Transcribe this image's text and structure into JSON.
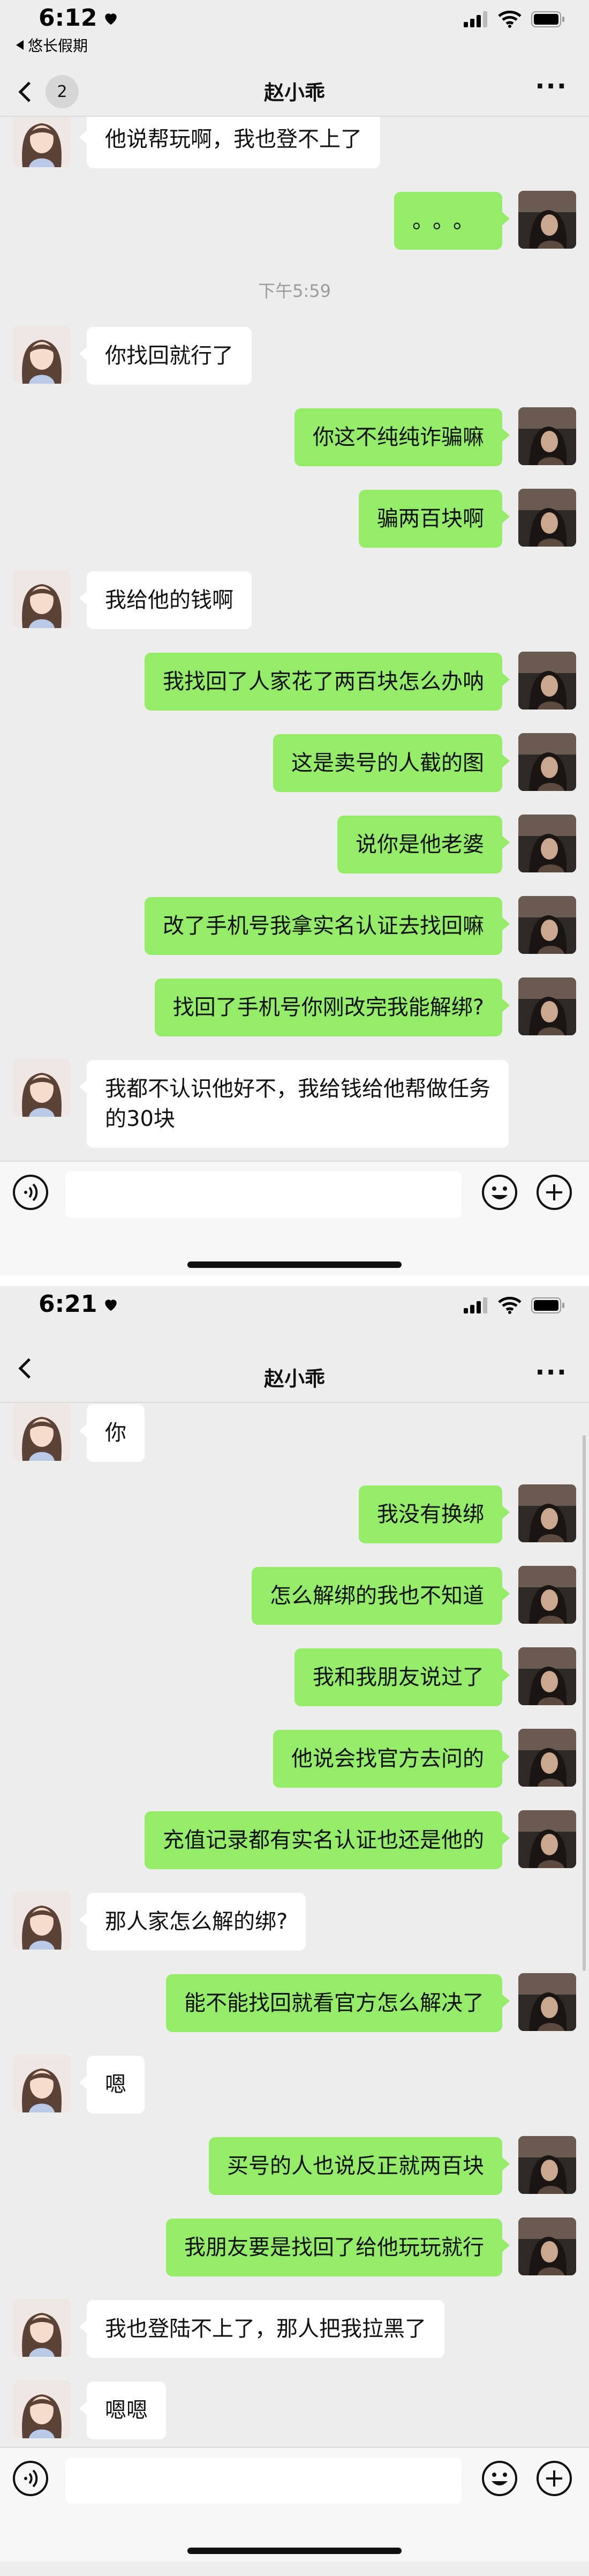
{
  "screenshots": [
    {
      "status": {
        "time": "6:12",
        "back_app": "悠长假期"
      },
      "nav": {
        "title": "赵小乖",
        "unread_badge": "2"
      },
      "messages": [
        {
          "side": "left",
          "text": "他说帮玩啊，我也登不上了"
        },
        {
          "side": "right",
          "text": "。。。"
        },
        {
          "type": "time",
          "text": "下午5:59"
        },
        {
          "side": "left",
          "text": "你找回就行了"
        },
        {
          "side": "right",
          "text": "你这不纯纯诈骗嘛"
        },
        {
          "side": "right",
          "text": "骗两百块啊"
        },
        {
          "side": "left",
          "text": "我给他的钱啊"
        },
        {
          "side": "right",
          "text": "我找回了人家花了两百块怎么办呐"
        },
        {
          "side": "right",
          "text": "这是卖号的人截的图"
        },
        {
          "side": "right",
          "text": "说你是他老婆"
        },
        {
          "side": "right",
          "text": "改了手机号我拿实名认证去找回嘛"
        },
        {
          "side": "right",
          "text": "找回了手机号你刚改完我能解绑?"
        },
        {
          "side": "left",
          "text": "我都不认识他好不，我给钱给他帮做任务的30块"
        }
      ]
    },
    {
      "status": {
        "time": "6:21",
        "back_app": ""
      },
      "nav": {
        "title": "赵小乖",
        "unread_badge": ""
      },
      "messages": [
        {
          "side": "left",
          "text": "你"
        },
        {
          "side": "right",
          "text": "我没有换绑"
        },
        {
          "side": "right",
          "text": "怎么解绑的我也不知道"
        },
        {
          "side": "right",
          "text": "我和我朋友说过了"
        },
        {
          "side": "right",
          "text": "他说会找官方去问的"
        },
        {
          "side": "right",
          "text": "充值记录都有实名认证也还是他的"
        },
        {
          "side": "left",
          "text": "那人家怎么解的绑?"
        },
        {
          "side": "right",
          "text": "能不能找回就看官方怎么解决了"
        },
        {
          "side": "left",
          "text": "嗯"
        },
        {
          "side": "right",
          "text": "买号的人也说反正就两百块"
        },
        {
          "side": "right",
          "text": "我朋友要是找回了给他玩玩就行"
        },
        {
          "side": "left",
          "text": "我也登陆不上了，那人把我拉黑了"
        },
        {
          "side": "left",
          "text": "嗯嗯"
        }
      ]
    }
  ],
  "icons": {
    "back": "chevron-left-icon",
    "more": "more-dots-icon",
    "voice": "voice-icon",
    "emoji": "emoji-icon",
    "plus": "plus-icon",
    "heart": "heart-icon",
    "signal": "signal-icon",
    "wifi": "wifi-icon",
    "battery": "battery-icon"
  },
  "colors": {
    "background": "#ededed",
    "sent_bubble": "#95ec69",
    "received_bubble": "#ffffff",
    "timestamp": "#9b9b9b"
  }
}
